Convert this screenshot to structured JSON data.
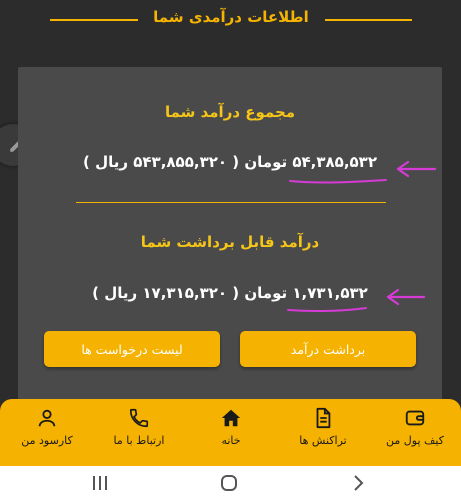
{
  "header": {
    "title": "اطلاعات درآمدی شما"
  },
  "total_income": {
    "title": "مجموع درآمد شما",
    "toman_value": "۵۴,۳۸۵,۵۳۲",
    "toman_unit": "تومان",
    "rial_text": "( ۵۴۳,۸۵۵,۳۲۰ ریال )"
  },
  "withdrawable_income": {
    "title": "درآمد قابل برداشت شما",
    "toman_value": "۱,۷۳۱,۵۳۲",
    "toman_unit": "تومان",
    "rial_text": "( ۱۷,۳۱۵,۳۲۰ ریال )"
  },
  "buttons": {
    "withdraw": "برداشت درآمد",
    "requests": "لیست درخواست ها"
  },
  "bottom_nav": {
    "wallet": "کیف پول من",
    "transactions": "تراکنش ها",
    "home": "خانه",
    "contact": "ارتباط با ما",
    "profile": "کارسود من"
  },
  "colors": {
    "accent": "#f6b200",
    "background": "#2c2c2c",
    "card": "#4a4a4a",
    "annotation": "#d63bd6"
  },
  "icons": {
    "edit": "pencil-icon",
    "wallet": "wallet-icon",
    "transactions": "document-icon",
    "home": "home-icon",
    "contact": "phone-icon",
    "profile": "user-icon"
  }
}
